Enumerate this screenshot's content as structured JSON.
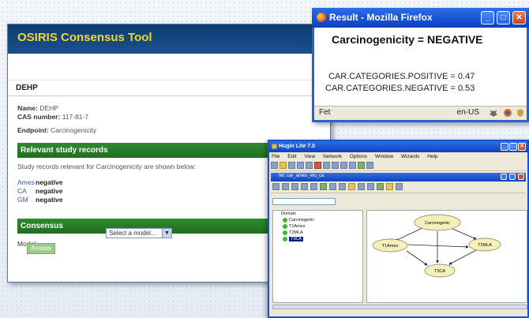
{
  "osiris": {
    "app_title": "OSIRIS Consensus Tool",
    "substance": "DEHP",
    "name_label": "Name:",
    "name_value": "DEHP",
    "cas_label": "CAS number:",
    "cas_value": "117-81-7",
    "endpoint_label": "Endpoint:",
    "endpoint_value": "Carcinogenicity",
    "relevant_header": "Relevant study records",
    "relevant_note": "Study records relevant for Carcinogenicity are shown below:",
    "records": [
      {
        "test": "Ames",
        "result": "negative"
      },
      {
        "test": "CA",
        "result": "negative"
      },
      {
        "test": "GM",
        "result": "negative"
      }
    ],
    "consensus_header": "Consensus",
    "model_label": "Model",
    "model_select": "Select a model...",
    "assess_button": "Assess"
  },
  "firefox": {
    "title": "Result - Mozilla Firefox",
    "heading": "Carcinogenicity = NEGATIVE",
    "line_positive": "CAR.CATEGORIES.POSITIVE = 0.47",
    "line_negative": "CAR.CATEGORIES.NEGATIVE = 0.53",
    "status_left": "Fet",
    "status_lang": "en-US"
  },
  "hugin": {
    "title": "Hugin Lite 7.0",
    "menu": [
      "File",
      "Edit",
      "View",
      "Network",
      "Options",
      "Window",
      "Wizards",
      "Help"
    ],
    "inner_title": "fet: car_ames_elu_ca",
    "tree": {
      "root": "Domain",
      "items": [
        "Carcinogenic",
        "T1Ames",
        "T2MLA",
        "T3CA"
      ],
      "selected": "T3CA"
    },
    "nodes": [
      "Carcinogenic",
      "T1Ames",
      "T2MLA",
      "T3CA"
    ],
    "node_color": "#f5f0b8"
  }
}
